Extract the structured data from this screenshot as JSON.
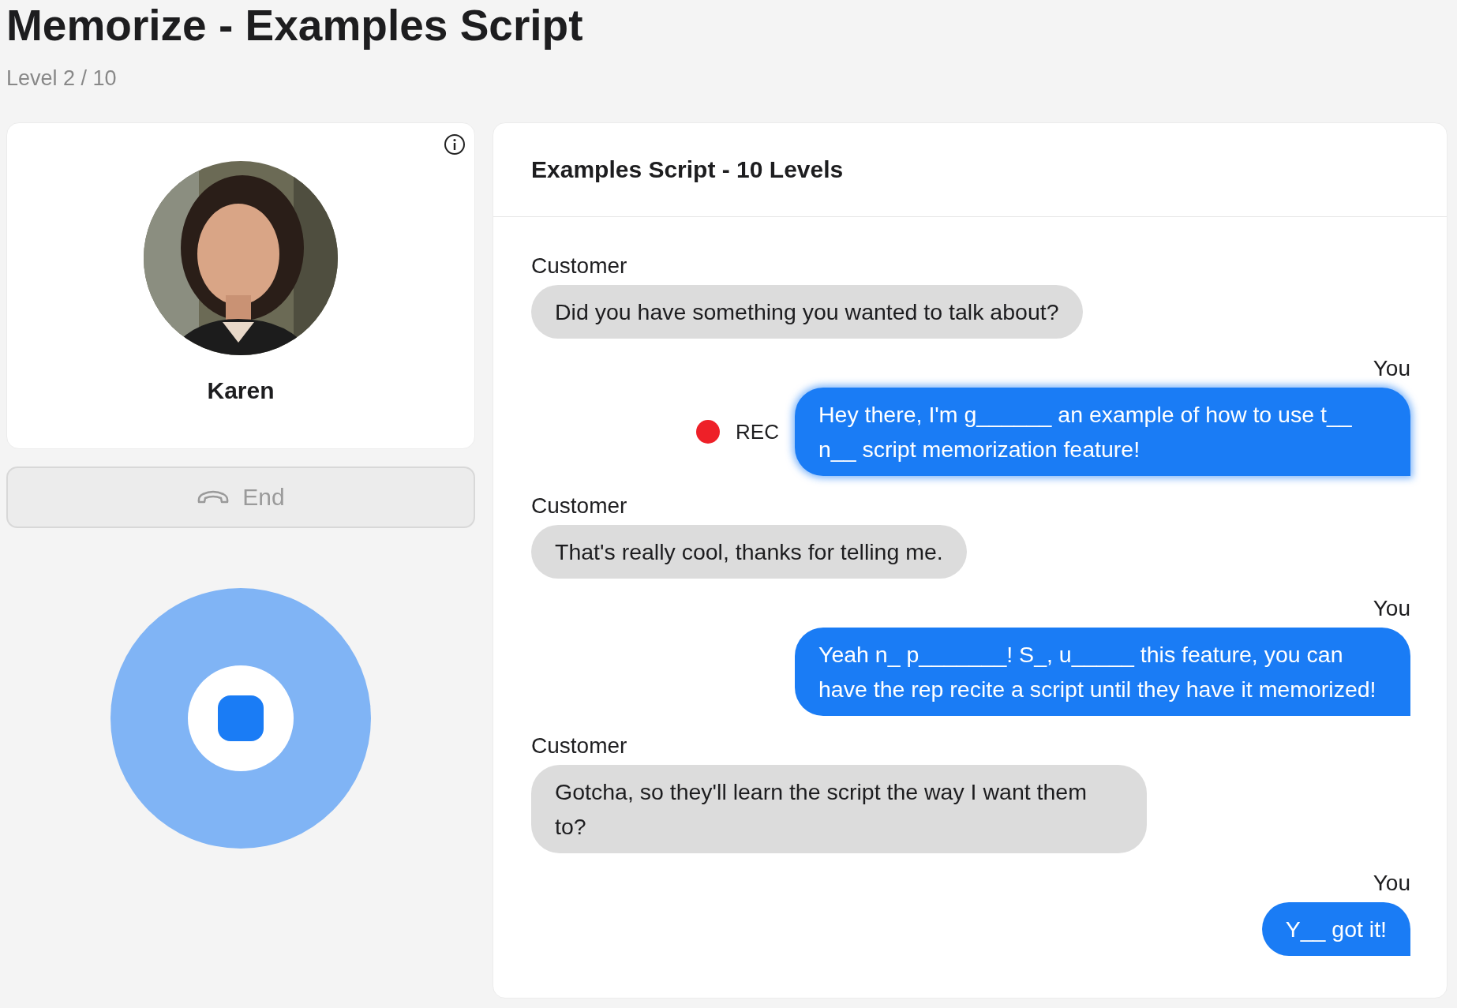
{
  "page": {
    "title": "Memorize - Examples Script",
    "subtitle": "Level 2 / 10"
  },
  "contact": {
    "name": "Karen"
  },
  "end_button": {
    "label": "End",
    "disabled": true
  },
  "record_button": {
    "recording": true
  },
  "chat": {
    "title": "Examples Script - 10 Levels",
    "messages": [
      {
        "speaker": "Customer",
        "kind": "incoming",
        "text": "Did you have something you wanted to talk about?",
        "recording": false
      },
      {
        "speaker": "You",
        "kind": "outgoing",
        "text": "Hey there, I'm g______ an example of how to use t__ n__ script memorization feature!",
        "recording": true,
        "rec_label": "REC"
      },
      {
        "speaker": "Customer",
        "kind": "incoming",
        "text": "That's really cool, thanks for telling me.",
        "recording": false
      },
      {
        "speaker": "You",
        "kind": "outgoing",
        "text": "Yeah n_ p_______! S_, u_____ this feature, you can have the rep recite a script until they have it memorized!",
        "recording": false
      },
      {
        "speaker": "Customer",
        "kind": "incoming",
        "text": "Gotcha, so they'll learn the script the way I want them to?",
        "recording": false
      },
      {
        "speaker": "You",
        "kind": "outgoing",
        "text": "Y__ got it!",
        "recording": false
      }
    ]
  }
}
